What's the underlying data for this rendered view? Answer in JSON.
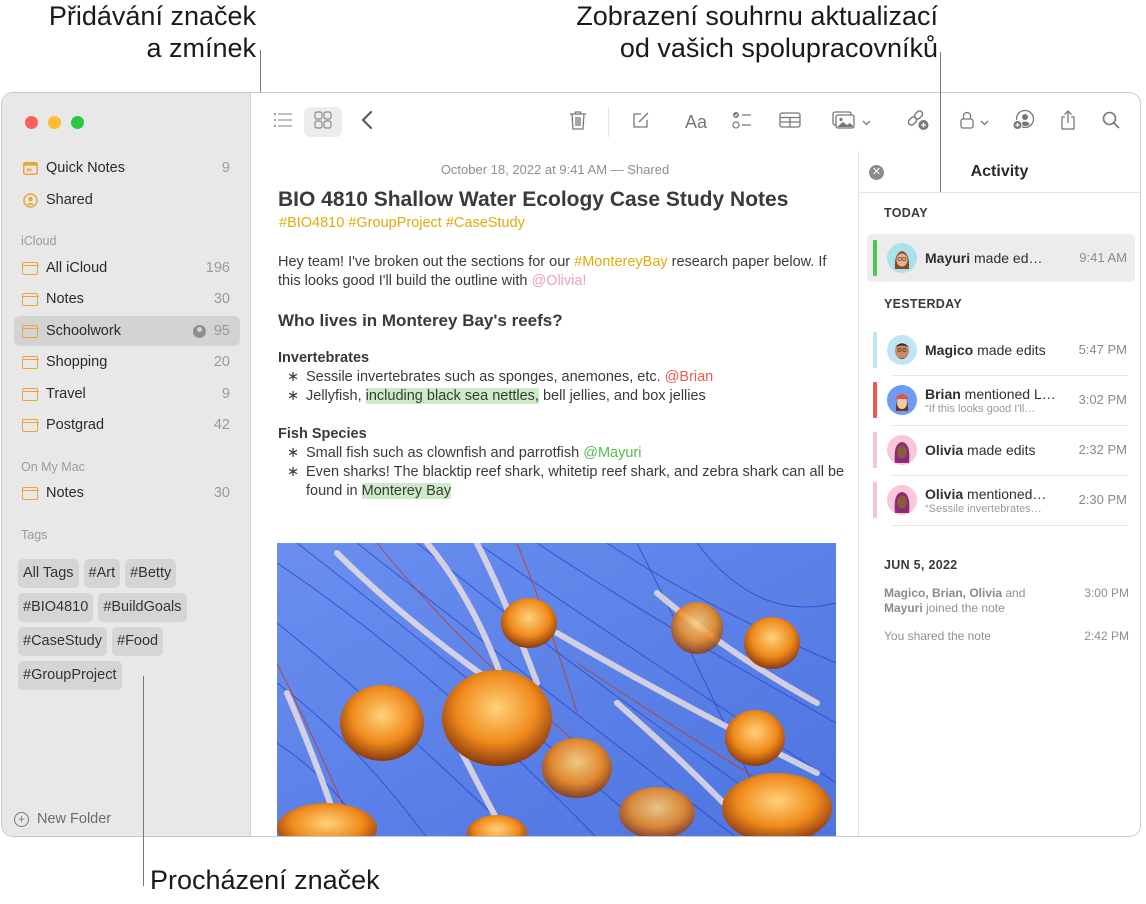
{
  "callouts": {
    "top_left": [
      "Přidávání značek",
      "a zmínek"
    ],
    "top_right": [
      "Zobrazení souhrnu aktualizací",
      "od vašich spolupracovníků"
    ],
    "bottom_left": "Procházení značek"
  },
  "sidebar": {
    "pinned": [
      {
        "label": "Quick Notes",
        "count": "9",
        "icon": "quick-notes-icon"
      },
      {
        "label": "Shared",
        "count": "",
        "icon": "shared-person-icon"
      }
    ],
    "sections": [
      {
        "title": "iCloud",
        "folders": [
          {
            "label": "All iCloud",
            "count": "196"
          },
          {
            "label": "Notes",
            "count": "30"
          },
          {
            "label": "Schoolwork",
            "count": "95",
            "selected": true,
            "shared": true
          },
          {
            "label": "Shopping",
            "count": "20"
          },
          {
            "label": "Travel",
            "count": "9"
          },
          {
            "label": "Postgrad",
            "count": "42"
          }
        ]
      },
      {
        "title": "On My Mac",
        "folders": [
          {
            "label": "Notes",
            "count": "30"
          }
        ]
      }
    ],
    "tags_title": "Tags",
    "tags": [
      "All Tags",
      "#Art",
      "#Betty",
      "#BIO4810",
      "#BuildGoals",
      "#CaseStudy",
      "#Food",
      "#GroupProject"
    ],
    "new_folder_label": "New Folder"
  },
  "toolbar": {
    "icons": [
      "list-view-icon",
      "gallery-view-icon",
      "back-chevron-icon",
      "trash-icon",
      "compose-icon",
      "format-text-icon",
      "checklist-icon",
      "table-icon",
      "media-icon",
      "collaborate-link-icon",
      "lock-icon",
      "add-people-icon",
      "share-icon",
      "search-icon"
    ],
    "format_label": "Aa"
  },
  "note": {
    "date": "October 18, 2022 at 9:41 AM — Shared",
    "title": "BIO 4810 Shallow Water Ecology Case Study Notes",
    "tags": "#BIO4810 #GroupProject #CaseStudy",
    "intro": {
      "p1": "Hey team! I've broken out the sections for our ",
      "hashtag": "#MontereyBay",
      "p2": " research paper below. If this looks good I'll build the outline with ",
      "mention": "@Olivia!"
    },
    "heading": "Who lives in Monterey Bay's reefs?",
    "sections": [
      {
        "title": "Invertebrates",
        "bullets": [
          {
            "text": "Sessile invertebrates such as sponges, anemones, etc. ",
            "mention": "@Brian"
          },
          {
            "pre": "Jellyfish, ",
            "highlight": "including black sea nettles,",
            "post": " bell jellies, and box jellies"
          }
        ]
      },
      {
        "title": "Fish Species",
        "bullets": [
          {
            "text": "Small fish such as clownfish and parrotfish ",
            "mention": "@Mayuri"
          },
          {
            "pre": "Even sharks! The blacktip reef shark, whitetip reef shark, and zebra shark can all be found in ",
            "highlight": "Monterey Bay",
            "post": ""
          }
        ]
      }
    ],
    "bullet_glyph": "∗",
    "image": "jellyfish-photo"
  },
  "activity": {
    "title": "Activity",
    "today_label": "TODAY",
    "yesterday_label": "YESTERDAY",
    "older_label": "JUN 5, 2022",
    "today": [
      {
        "name": "Mayuri",
        "action": " made ed…",
        "sub": "",
        "time": "9:41 AM",
        "color": "#4cc94a",
        "avatar_bg": "#a9e3ea"
      }
    ],
    "yesterday": [
      {
        "name": "Magico",
        "action": " made edits",
        "sub": "",
        "time": "5:47 PM",
        "color": "#bfe6f7",
        "avatar_bg": "#bfe6f7"
      },
      {
        "name": "Brian",
        "action": " mentioned L…",
        "sub": "“If this looks good I'll…",
        "time": "3:02 PM",
        "color": "#ec5a4e",
        "avatar_bg": "#6f9cf2"
      },
      {
        "name": "Olivia",
        "action": " made edits",
        "sub": "",
        "time": "2:32 PM",
        "color": "#f8c4d4",
        "avatar_bg": "#f9c7d8"
      },
      {
        "name": "Olivia",
        "action": " mentioned…",
        "sub": "“Sessile invertebrates…",
        "time": "2:30 PM",
        "color": "#f8c4d4",
        "avatar_bg": "#f9c7d8"
      }
    ],
    "older": [
      {
        "names": "Magico, Brian, Olivia",
        "and": " and ",
        "last": "Mayuri",
        "rest": " joined the note",
        "time": "3:00 PM"
      },
      {
        "text": "You shared the note",
        "time": "2:42 PM"
      }
    ]
  },
  "colors": {
    "accent_yellow": "#e3a90d",
    "folder_orange": "#e9a53a",
    "mention_olivia": "#f29cc0",
    "mention_brian": "#ef5a4d",
    "mention_mayuri": "#4fbf4a",
    "highlight_green": "#cdebc6"
  }
}
